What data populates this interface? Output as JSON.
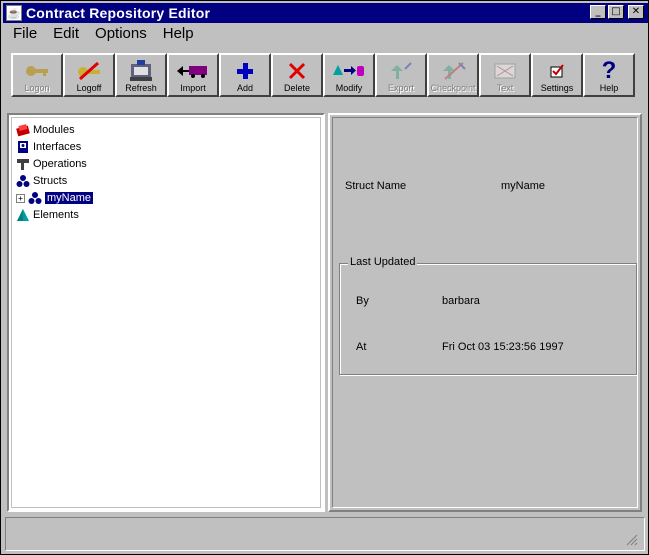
{
  "window": {
    "title": "Contract Repository Editor"
  },
  "menu": [
    "File",
    "Edit",
    "Options",
    "Help"
  ],
  "toolbar": [
    {
      "label": "Logon",
      "icon": "key-icon",
      "enabled": false
    },
    {
      "label": "Logoff",
      "icon": "key-cancel-icon",
      "enabled": true
    },
    {
      "label": "Refresh",
      "icon": "refresh-icon",
      "enabled": true
    },
    {
      "label": "Import",
      "icon": "import-truck-icon",
      "enabled": true
    },
    {
      "label": "Add",
      "icon": "plus-icon",
      "enabled": true
    },
    {
      "label": "Delete",
      "icon": "x-icon",
      "enabled": true
    },
    {
      "label": "Modify",
      "icon": "modify-icon",
      "enabled": true
    },
    {
      "label": "Export",
      "icon": "export-icon",
      "enabled": false
    },
    {
      "label": "Checkpoint",
      "icon": "checkpoint-icon",
      "enabled": false
    },
    {
      "label": "Text",
      "icon": "text-icon",
      "enabled": false
    },
    {
      "label": "Settings",
      "icon": "settings-icon",
      "enabled": true
    },
    {
      "label": "Help",
      "icon": "question-icon",
      "enabled": true
    }
  ],
  "tree": [
    {
      "label": "Modules",
      "icon": "modules-icon",
      "selected": false
    },
    {
      "label": "Interfaces",
      "icon": "interfaces-icon",
      "selected": false
    },
    {
      "label": "Operations",
      "icon": "operations-icon",
      "selected": false
    },
    {
      "label": "Structs",
      "icon": "structs-icon",
      "selected": false
    },
    {
      "label": "myName",
      "icon": "struct-icon",
      "selected": true,
      "expander": "+"
    },
    {
      "label": "Elements",
      "icon": "elements-icon",
      "selected": false
    }
  ],
  "detail": {
    "struct_name_label": "Struct Name",
    "struct_name_value": "myName",
    "last_updated_title": "Last Updated",
    "by_label": "By",
    "by_value": "barbara",
    "at_label": "At",
    "at_value": "Fri Oct 03 15:23:56  1997"
  },
  "colors": {
    "titlebar": "#000080",
    "selection": "#000080",
    "face": "#c0c0c0"
  }
}
